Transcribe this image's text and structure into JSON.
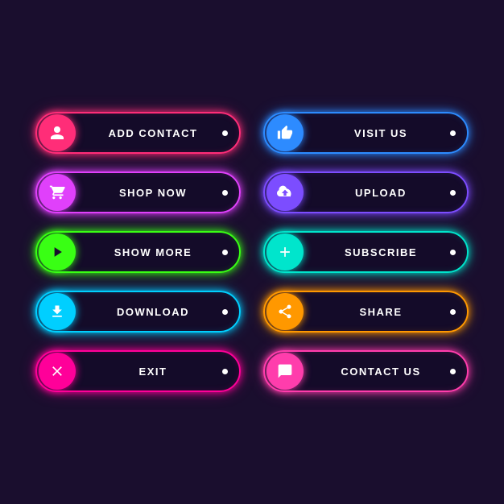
{
  "buttons": [
    {
      "id": "add-contact",
      "label": "ADD CONTACT",
      "icon": "person",
      "color": "red",
      "col": 1
    },
    {
      "id": "visit-us",
      "label": "VISIT US",
      "icon": "thumb_up",
      "color": "blue",
      "col": 2
    },
    {
      "id": "shop-now",
      "label": "SHOP NOW",
      "icon": "shopping_cart",
      "color": "pink",
      "col": 1
    },
    {
      "id": "upload",
      "label": "UPLOAD",
      "icon": "upload",
      "color": "purple",
      "col": 2
    },
    {
      "id": "show-more",
      "label": "SHOW MORE",
      "icon": "play_arrow",
      "color": "green",
      "col": 1
    },
    {
      "id": "subscribe",
      "label": "SUBSCRIBE",
      "icon": "add",
      "color": "teal",
      "col": 2
    },
    {
      "id": "download",
      "label": "DOWNLOAD",
      "icon": "download",
      "color": "cyan",
      "col": 1
    },
    {
      "id": "share",
      "label": "SHARE",
      "icon": "share",
      "color": "orange",
      "col": 2
    },
    {
      "id": "exit",
      "label": "EXIT",
      "icon": "close",
      "color": "magenta",
      "col": 1
    },
    {
      "id": "contact-us",
      "label": "CONTACT US",
      "icon": "chat_bubble",
      "color": "hotpink",
      "col": 2
    }
  ]
}
